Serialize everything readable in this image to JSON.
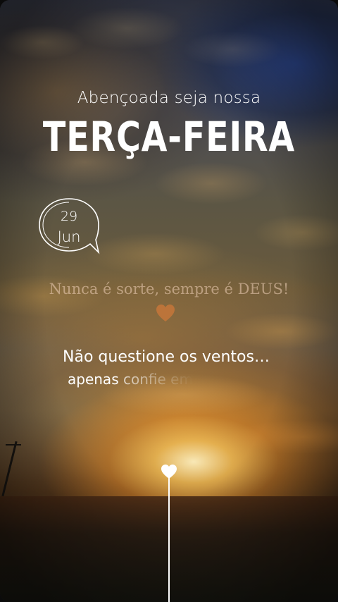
{
  "story": {
    "subtitle": "Abençoada seja nossa",
    "title": "TERÇA-FEIRA",
    "date": {
      "day": "29",
      "month": "Jun"
    },
    "quote": "Nunca é sorte, sempre é DEUS!",
    "quote_icon": "orange-heart-icon",
    "message_line1": "Não questione os ventos…",
    "message_line2_visible": "apenas",
    "message_line2_fading": "confie em",
    "bottom_icon": "white-heart-icon"
  },
  "colors": {
    "text": "#ffffff",
    "quote": "#f0d2b9",
    "heart_orange": "#e08a3c"
  }
}
